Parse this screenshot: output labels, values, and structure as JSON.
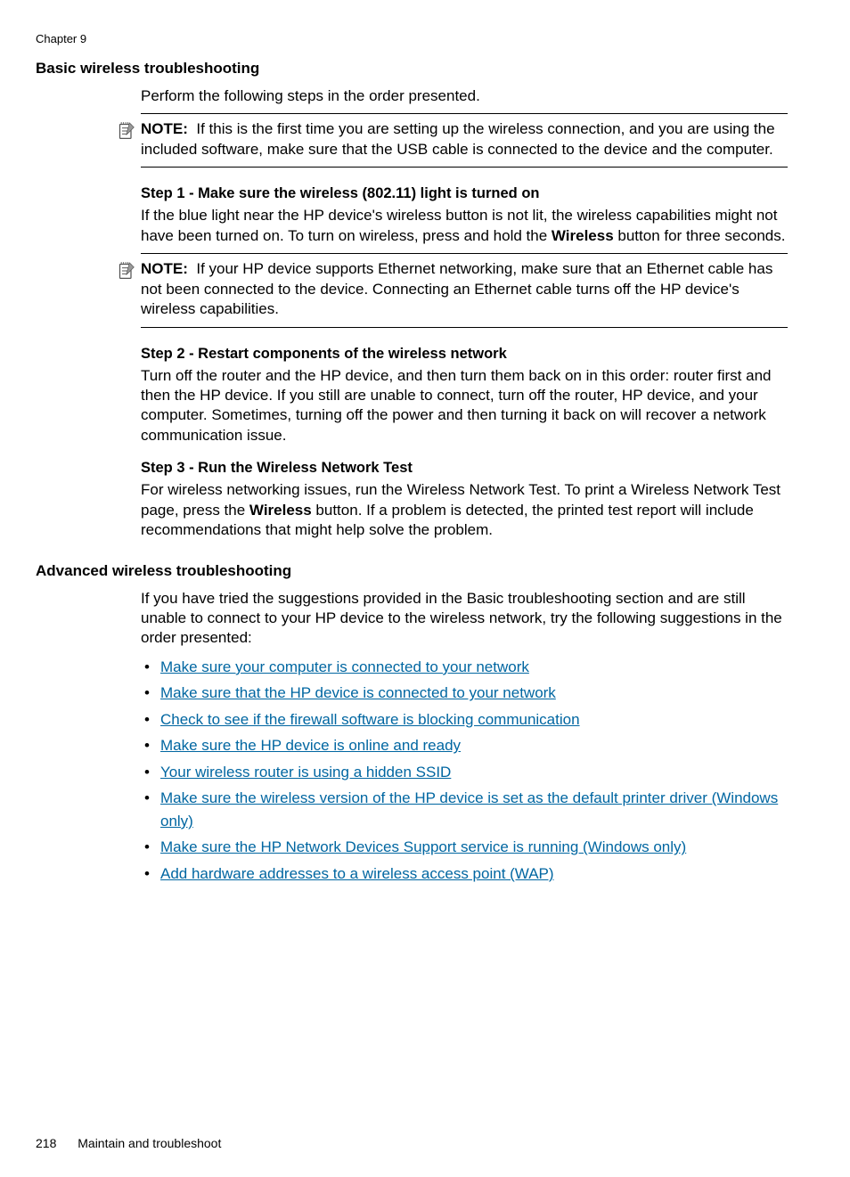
{
  "chapter": "Chapter 9",
  "sec_basic": {
    "title": "Basic wireless troubleshooting",
    "intro": "Perform the following steps in the order presented.",
    "note1_full": "If this is the first time you are setting up the wireless connection, and you are using the included software, make sure that the USB cable is connected to the device and the computer.",
    "step1": {
      "h": "Step 1 - Make sure the wireless (802.11) light is turned on",
      "p_a": "If the blue light near the HP device's wireless button is not lit, the wireless capabilities might not have been turned on. To turn on wireless, press and hold the ",
      "p_bold": "Wireless",
      "p_b": " button for three seconds.",
      "note_full": "If your HP device supports Ethernet networking, make sure that an Ethernet cable has not been connected to the device. Connecting an Ethernet cable turns off the HP device's wireless capabilities."
    },
    "step2": {
      "h": "Step 2 - Restart components of the wireless network",
      "p": "Turn off the router and the HP device, and then turn them back on in this order: router first and then the HP device. If you still are unable to connect, turn off the router, HP device, and your computer. Sometimes, turning off the power and then turning it back on will recover a network communication issue."
    },
    "step3": {
      "h": "Step 3 - Run the Wireless Network Test",
      "p_a": "For wireless networking issues, run the Wireless Network Test. To print a Wireless Network Test page, press the ",
      "p_bold": "Wireless",
      "p_b": " button. If a problem is detected, the printed test report will include recommendations that might help solve the problem."
    }
  },
  "sec_advanced": {
    "title": "Advanced wireless troubleshooting",
    "intro": "If you have tried the suggestions provided in the Basic troubleshooting section and are still unable to connect to your HP device to the wireless network, try the following suggestions in the order presented:",
    "links": [
      "Make sure your computer is connected to your network",
      "Make sure that the HP device is connected to your network",
      "Check to see if the firewall software is blocking communication",
      "Make sure the HP device is online and ready",
      "Your wireless router is using a hidden SSID",
      "Make sure the wireless version of the HP device is set as the default printer driver (Windows only)",
      "Make sure the HP Network Devices Support service is running (Windows only)",
      "Add hardware addresses to a wireless access point (WAP)"
    ]
  },
  "note_label": "NOTE:",
  "footer": {
    "page": "218",
    "title": "Maintain and troubleshoot"
  }
}
